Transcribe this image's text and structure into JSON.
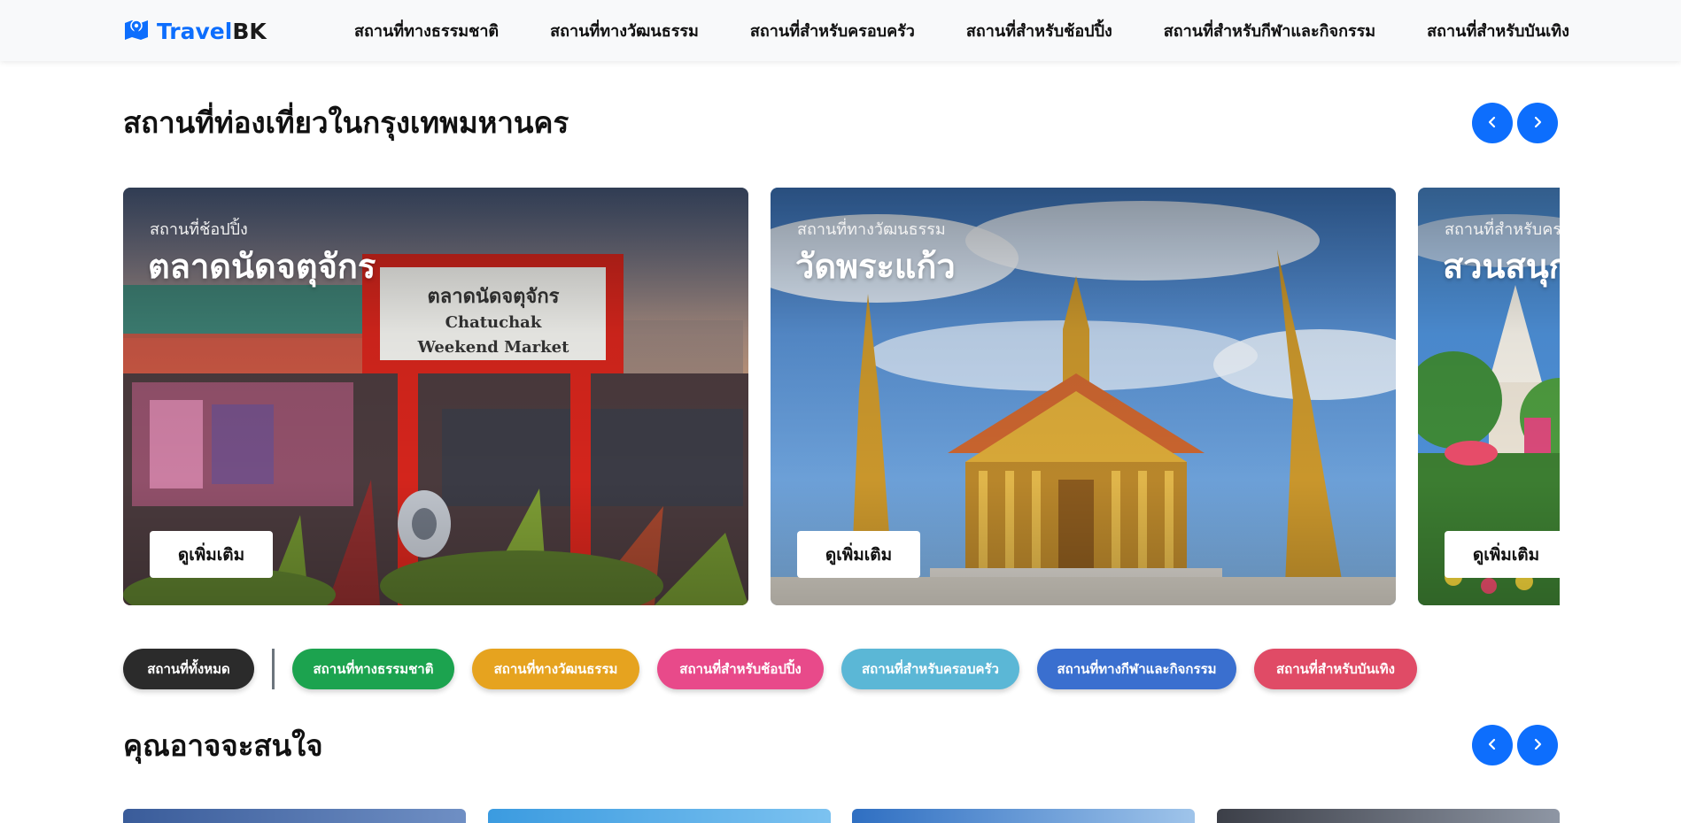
{
  "brand": {
    "name_part1": "Travel",
    "name_part2": "BK",
    "icon": "map-marker-icon",
    "accent": "#0d6efd"
  },
  "nav": [
    "สถานที่ทางธรรมชาติ",
    "สถานที่ทางวัฒนธรรม",
    "สถานที่สำหรับครอบครัว",
    "สถานที่สำหรับช้อปปิ้ง",
    "สถานที่สำหรับกีฬาและกิจกรรม",
    "สถานที่สำหรับบันเทิง"
  ],
  "section1": {
    "title": "สถานที่ท่องเที่ยวในกรุงเทพมหานคร",
    "prev_icon": "chevron-left-icon",
    "next_icon": "chevron-right-icon"
  },
  "cards": [
    {
      "category": "สถานที่ช้อปปิ้ง",
      "title": "ตลาดนัดจตุจักร",
      "button": "ดูเพิ่มเติม"
    },
    {
      "category": "สถานที่ทางวัฒนธรรม",
      "title": "วัดพระแก้ว",
      "button": "ดูเพิ่มเติม"
    },
    {
      "category": "สถานที่สำหรับครอบครัว",
      "title": "สวนสนุก",
      "button": "ดูเพิ่มเติม"
    }
  ],
  "filters": [
    {
      "label": "สถานที่ทั้งหมด",
      "color": "#2b2b2b"
    },
    {
      "label": "สถานที่ทางธรรมชาติ",
      "color": "#1ca34f"
    },
    {
      "label": "สถานที่ทางวัฒนธรรม",
      "color": "#e6a31f"
    },
    {
      "label": "สถานที่สำหรับช้อปปิ้ง",
      "color": "#e84a8a"
    },
    {
      "label": "สถานที่สำหรับครอบครัว",
      "color": "#5bb7d6"
    },
    {
      "label": "สถานที่ทางกีฬาและกิจกรรม",
      "color": "#3a6fcf"
    },
    {
      "label": "สถานที่สำหรับบันเทิง",
      "color": "#e04b66"
    }
  ],
  "section2": {
    "title": "คุณอาจจะสนใจ",
    "prev_icon": "chevron-left-icon",
    "next_icon": "chevron-right-icon"
  }
}
